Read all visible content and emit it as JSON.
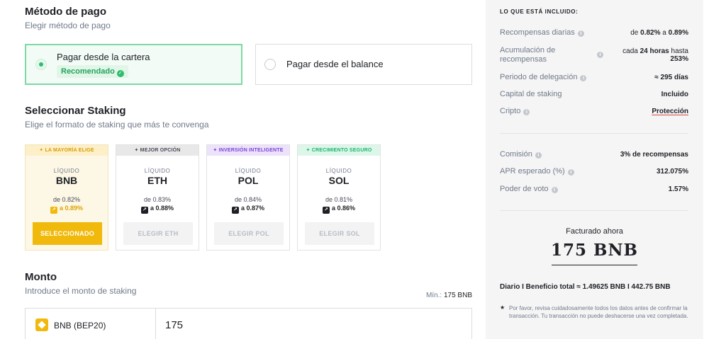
{
  "payment": {
    "title": "Método de pago",
    "subtitle": "Elegir método de pago",
    "options": [
      {
        "label": "Pagar desde la cartera",
        "badge": "Recomendado",
        "selected": true
      },
      {
        "label": "Pagar desde el balance",
        "selected": false
      }
    ]
  },
  "staking": {
    "title": "Seleccionar Staking",
    "subtitle": "Elige el formato de staking que más te convenga",
    "cards": [
      {
        "tag": "LA MAYORÍA ELIGE",
        "tag_bg": "#fdf0c9",
        "tag_color": "#d79d00",
        "kind": "LÍQUIDO",
        "coin": "BNB",
        "from": "de 0.82%",
        "to": "a 0.89%",
        "button": "SELECCIONADO",
        "selected": true
      },
      {
        "tag": "MEJOR OPCIÓN",
        "tag_bg": "#e8e8e8",
        "tag_color": "#474d57",
        "kind": "LÍQUIDO",
        "coin": "ETH",
        "from": "de 0.83%",
        "to": "a 0.88%",
        "button": "ELEGIR ETH",
        "selected": false
      },
      {
        "tag": "INVERSIÓN INTELIGENTE",
        "tag_bg": "#ece2fb",
        "tag_color": "#7b43d6",
        "kind": "LÍQUIDO",
        "coin": "POL",
        "from": "de 0.84%",
        "to": "a 0.87%",
        "button": "ELEGIR POL",
        "selected": false
      },
      {
        "tag": "CRECIMIENTO SEGURO",
        "tag_bg": "#dcf7ea",
        "tag_color": "#1eb36d",
        "kind": "LÍQUIDO",
        "coin": "SOL",
        "from": "de 0.81%",
        "to": "a 0.86%",
        "button": "ELEGIR SOL",
        "selected": false
      }
    ]
  },
  "amount": {
    "title": "Monto",
    "subtitle": "Introduce el monto de staking",
    "min_label": "Mín.:",
    "min_value": "175 BNB",
    "token": "BNB (BEP20)",
    "value": "175"
  },
  "included": {
    "title": "LO QUE ESTÁ INCLUIDO:",
    "rows": [
      {
        "label": "Recompensas diarias",
        "value_prefix": "de ",
        "value_bold": "0.82%",
        "value_mid": " a ",
        "value_bold2": "0.89%"
      },
      {
        "label": "Acumulación de recompensas",
        "value_prefix": "cada ",
        "value_bold": "24 horas",
        "value_mid": " hasta ",
        "value_bold2": "253%"
      },
      {
        "label": "Periodo de delegación",
        "value": "≈ 295 días"
      },
      {
        "label": "Capital de staking",
        "value": "Incluido"
      },
      {
        "label": "Cripto",
        "value": "Protección"
      }
    ],
    "fees": [
      {
        "label": "Comisión",
        "value": "3% de recompensas"
      },
      {
        "label": "APR esperado (%)",
        "value": "312.075%"
      },
      {
        "label": "Poder de voto",
        "value": "1.57%"
      }
    ],
    "billed_label": "Facturado ahora",
    "billed_value": "175 BNB",
    "daily_total": "Diario I Beneficio total  ≈ 1.49625 BNB I 442.75 BNB",
    "note": "Por favor, revisa cuidadosamente todos los datos antes de confirmar la transacción. Tu transacción no puede deshacerse una vez completada."
  }
}
